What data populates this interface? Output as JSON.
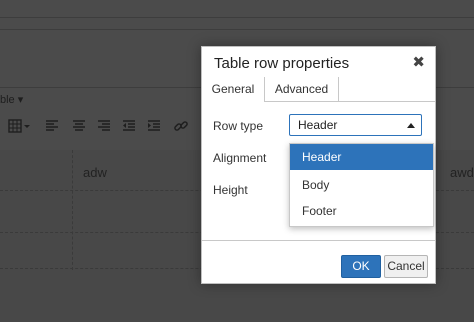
{
  "background": {
    "menu_label": "ble ▾",
    "cells": [
      "adw",
      "awd"
    ],
    "toolbar_icons": [
      "table-icon",
      "align-left-icon",
      "align-center-icon",
      "align-right-icon",
      "outdent-icon",
      "indent-icon",
      "link-icon"
    ]
  },
  "dialog": {
    "title": "Table row properties",
    "close": "✖",
    "tabs": [
      {
        "label": "General",
        "active": true
      },
      {
        "label": "Advanced",
        "active": false
      }
    ],
    "fields": {
      "row_type_label": "Row type",
      "row_type_value": "Header",
      "alignment_label": "Alignment",
      "height_label": "Height"
    },
    "dropdown_options": [
      {
        "label": "Header",
        "selected": true
      },
      {
        "label": "Body",
        "selected": false
      },
      {
        "label": "Footer",
        "selected": false
      }
    ],
    "buttons": {
      "ok": "OK",
      "cancel": "Cancel"
    }
  },
  "colors": {
    "accent": "#2d73ba",
    "overlay": "#4b4b4b"
  }
}
